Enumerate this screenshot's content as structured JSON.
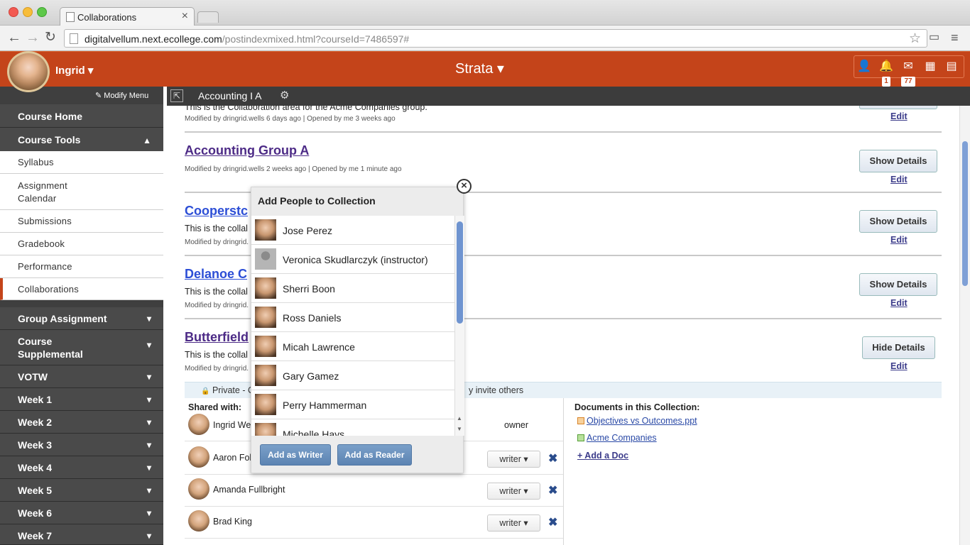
{
  "browser": {
    "tab_title": "Collaborations",
    "url_host": "digitalvellum.next.ecollege.com",
    "url_path": "/postindexmixed.html?courseId=7486597#"
  },
  "header": {
    "user_name": "Ingrid",
    "brand": "Strata",
    "notifications_count": "1",
    "messages_count": "77",
    "accent": "#c4441a"
  },
  "sidebar": {
    "modify_menu": "Modify Menu",
    "course_home": "Course Home",
    "course_tools": "Course Tools",
    "tools": [
      "Syllabus",
      "Assignment Calendar",
      "Submissions",
      "Gradebook",
      "Performance",
      "Collaborations"
    ],
    "group_assignment": "Group Assignment",
    "course_supplemental": "Course Supplemental",
    "votw": "VOTW",
    "weeks": [
      "Week 1",
      "Week 2",
      "Week 3",
      "Week 4",
      "Week 5",
      "Week 6",
      "Week 7"
    ]
  },
  "course_bar": {
    "name": "Accounting I A"
  },
  "collaborations": {
    "top_desc": "This is the Collaboration area for the Acme Companies group.",
    "top_meta": "Modified by dringrid.wells 6 days ago | Opened by me 3 weeks ago",
    "edit": "Edit",
    "show_details": "Show Details",
    "hide_details": "Hide Details",
    "items": [
      {
        "title": "Accounting Group A",
        "desc": "",
        "meta": "Modified by dringrid.wells 2 weeks ago | Opened by me 1 minute ago"
      },
      {
        "title": "Cooperstc",
        "desc": "This is the collal",
        "meta": "Modified by dringrid."
      },
      {
        "title": "Delanoe C",
        "desc": "This is the collal",
        "meta": "Modified by dringrid."
      },
      {
        "title": "Butterfield",
        "desc": "This is the collal",
        "meta": "Modified by dringrid."
      }
    ]
  },
  "detail": {
    "privacy_left": "Private - On",
    "privacy_right": "y invite others",
    "shared_with_label": "Shared with:",
    "shared": [
      {
        "name": "Ingrid We",
        "role": "owner"
      },
      {
        "name": "Aaron Fol",
        "role": "writer"
      },
      {
        "name": "Amanda Fullbright",
        "role": "writer"
      },
      {
        "name": "Brad King",
        "role": "writer"
      }
    ],
    "documents_label": "Documents in this Collection:",
    "documents": [
      "Objectives vs Outcomes.ppt",
      "Acme Companies"
    ],
    "add_doc": "+ Add a Doc"
  },
  "popup": {
    "title": "Add People to Collection",
    "people": [
      "Jose Perez",
      "Veronica Skudlarczyk (instructor)",
      "Sherri Boon",
      "Ross Daniels",
      "Micah Lawrence",
      "Gary Gamez",
      "Perry Hammerman",
      "Michelle Hays"
    ],
    "add_writer": "Add as Writer",
    "add_reader": "Add as Reader"
  }
}
